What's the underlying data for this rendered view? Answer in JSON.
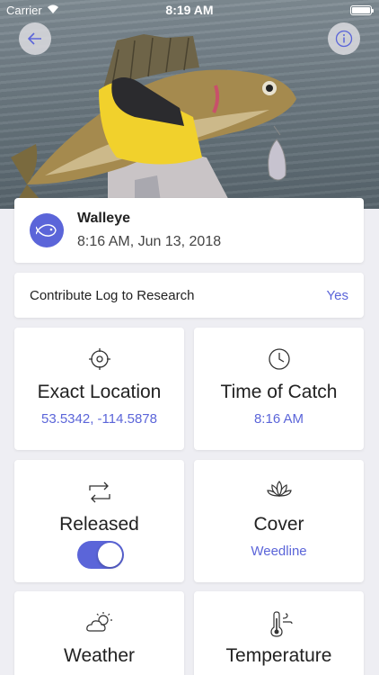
{
  "status_bar": {
    "carrier": "Carrier",
    "time": "8:19 AM"
  },
  "hero": {
    "subject": "walleye-fish-photo"
  },
  "nav": {
    "back_icon": "back-arrow-icon",
    "info_icon": "info-icon"
  },
  "catch": {
    "species": "Walleye",
    "datetime": "8:16 AM, Jun 13, 2018",
    "icon": "fish-icon"
  },
  "contribute": {
    "label": "Contribute Log to Research",
    "value": "Yes"
  },
  "tiles": {
    "location": {
      "title": "Exact Location",
      "value": "53.5342, -114.5878",
      "icon": "crosshair-icon"
    },
    "time": {
      "title": "Time of Catch",
      "value": "8:16 AM",
      "icon": "clock-icon"
    },
    "released": {
      "title": "Released",
      "toggle_on": true,
      "icon": "release-arrows-icon"
    },
    "cover": {
      "title": "Cover",
      "value": "Weedline",
      "icon": "lotus-icon"
    },
    "weather": {
      "title": "Weather",
      "icon": "partly-cloudy-icon"
    },
    "temperature": {
      "title": "Temperature",
      "icon": "thermometer-icon"
    }
  },
  "colors": {
    "accent": "#5b65d9",
    "background": "#eeeef3"
  }
}
